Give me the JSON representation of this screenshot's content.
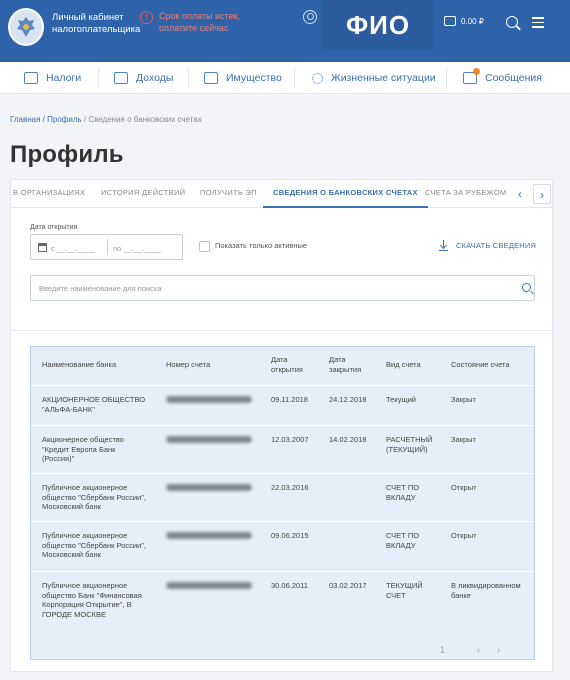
{
  "header": {
    "brand_line1": "Личный кабинет",
    "brand_line2": "налогоплательщика",
    "alert_line1": "Срок оплаты истек,",
    "alert_line2": "оплатите сейчас",
    "user_name": "ФИО",
    "balance": "0.00 ₽"
  },
  "nav": [
    {
      "label": "Налоги",
      "icon": "taxes-icon"
    },
    {
      "label": "Доходы",
      "icon": "income-icon"
    },
    {
      "label": "Имущество",
      "icon": "property-icon"
    },
    {
      "label": "Жизненные ситуации",
      "icon": "life-situations-icon"
    },
    {
      "label": "Сообщения",
      "icon": "messages-icon"
    }
  ],
  "breadcrumb": {
    "home": "Главная",
    "sep1": " / ",
    "profile": "Профиль",
    "sep2": " / ",
    "current": "Сведения о банковских счетах"
  },
  "page_title": "Профиль",
  "tabs": [
    {
      "label": "В ОРГАНИЗАЦИЯХ",
      "active": false
    },
    {
      "label": "ИСТОРИЯ ДЕЙСТВИЙ",
      "active": false
    },
    {
      "label": "ПОЛУЧИТЬ ЭП",
      "active": false
    },
    {
      "label": "СВЕДЕНИЯ О БАНКОВСКИХ СЧЕТАХ",
      "active": true
    },
    {
      "label": "СЧЕТА ЗА РУБЕЖОМ",
      "active": false
    }
  ],
  "tab_arrows": {
    "prev": "‹",
    "next": "›"
  },
  "filters": {
    "date_label": "Дата открытия",
    "date_from": "с __.__.____",
    "date_to": "по __.__.____",
    "active_only": "Показать только активные",
    "download": "СКАЧАТЬ СВЕДЕНИЯ",
    "search_placeholder": "Введите наименование для поиска"
  },
  "table": {
    "headers": {
      "bank": "Наименование банка",
      "account": "Номер счета",
      "opened_1": "Дата",
      "opened_2": "открытия",
      "closed_1": "Дата",
      "closed_2": "закрытия",
      "type": "Вид счета",
      "status": "Состояние счета"
    },
    "rows": [
      {
        "bank": [
          "АКЦИОНЕРНОЕ ОБЩЕСТВО",
          "\"АЛЬФА-БАНК\""
        ],
        "opened": "09.11.2018",
        "closed": "24.12.2018",
        "type": [
          "Текущий"
        ],
        "status": [
          "Закрыт"
        ]
      },
      {
        "bank": [
          "Акционерное общество",
          "\"Кредит Европа Банк",
          "(Россия)\""
        ],
        "opened": "12.03.2007",
        "closed": "14.02.2018",
        "type": [
          "РАСЧЕТНЫЙ",
          "(ТЕКУЩИЙ)"
        ],
        "status": [
          "Закрыт"
        ]
      },
      {
        "bank": [
          "Публичное акционерное",
          "общество \"Сбербанк России\",",
          "Московский банк"
        ],
        "opened": "22.03.2016",
        "closed": "",
        "type": [
          "СЧЕТ ПО",
          "ВКЛАДУ"
        ],
        "status": [
          "Открыт"
        ]
      },
      {
        "bank": [
          "Публичное акционерное",
          "общество \"Сбербанк России\",",
          "Московский банк"
        ],
        "opened": "09.06.2015",
        "closed": "",
        "type": [
          "СЧЕТ ПО",
          "ВКЛАДУ"
        ],
        "status": [
          "Открыт"
        ]
      },
      {
        "bank": [
          "Публичное акционерное",
          "общество Банк \"Финансовая",
          "Корпорация Открытие\", В",
          "ГОРОДЕ МОСКВЕ"
        ],
        "opened": "30.06.2011",
        "closed": "03.02.2017",
        "type": [
          "ТЕКУЩИЙ",
          "СЧЕТ"
        ],
        "status": [
          "В ликвидированном",
          "банке"
        ]
      }
    ]
  },
  "pagination": {
    "page": "1",
    "prev": "‹",
    "next": "›"
  },
  "colors": {
    "header_bg": "#2e63a9",
    "accent": "#3a6fb2",
    "alert": "#e05656",
    "table_bg": "#e6eff9"
  }
}
